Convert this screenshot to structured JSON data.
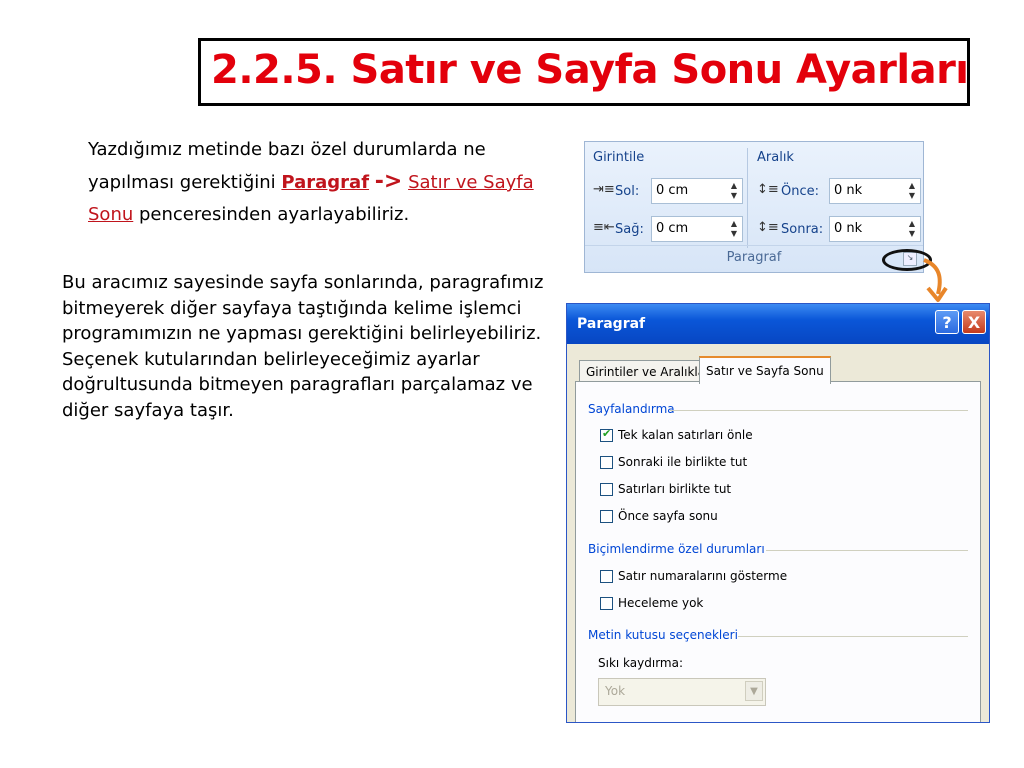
{
  "slide": {
    "title": "2.2.5. Satır ve Sayfa Sonu Ayarları",
    "intro": {
      "text1": "Yazdığımız metinde bazı özel durumlarda ne yapılması gerektiğini ",
      "link1": "Paragraf",
      "arrow": "->",
      "link2": "Satır ve Sayfa Sonu",
      "text2": " penceresinden ayarlayabiliriz."
    },
    "body": "Bu aracımız sayesinde sayfa sonlarında, paragrafımız bitmeyerek diğer sayfaya taştığında kelime işlemci programımızın ne yapması gerektiğini belirleyebiliriz. Seçenek kutularından belirleyeceğimiz ayarlar doğrultusunda bitmeyen paragrafları parçalamaz ve diğer sayfaya taşır."
  },
  "ribbon": {
    "group1": "Girintile",
    "group2": "Aralık",
    "left_label": "Sol:",
    "left_value": "0 cm",
    "right_label": "Sağ:",
    "right_value": "0 cm",
    "before_label": "Önce:",
    "before_value": "0 nk",
    "after_label": "Sonra:",
    "after_value": "0 nk",
    "footer": "Paragraf"
  },
  "dialog": {
    "title": "Paragraf",
    "help": "?",
    "close": "X",
    "tabs": [
      "Girintiler ve Aralıklar",
      "Satır ve Sayfa Sonu"
    ],
    "active_tab": 1,
    "section1": "Sayfalandırma",
    "options1": [
      {
        "label": "Tek kalan satırları önle",
        "checked": true
      },
      {
        "label": "Sonraki ile birlikte tut",
        "checked": false
      },
      {
        "label": "Satırları birlikte tut",
        "checked": false
      },
      {
        "label": "Önce sayfa sonu",
        "checked": false
      }
    ],
    "section2": "Biçimlendirme özel durumları",
    "options2": [
      {
        "label": "Satır numaralarını gösterme",
        "checked": false
      },
      {
        "label": "Heceleme yok",
        "checked": false
      }
    ],
    "section3": "Metin kutusu seçenekleri",
    "wrap_label": "Sıkı kaydırma:",
    "wrap_value": "Yok"
  },
  "colors": {
    "title_red": "#e3000b",
    "link_red": "#c0141c",
    "section_blue": "#0046d5",
    "arrow_orange": "#e8862a"
  }
}
